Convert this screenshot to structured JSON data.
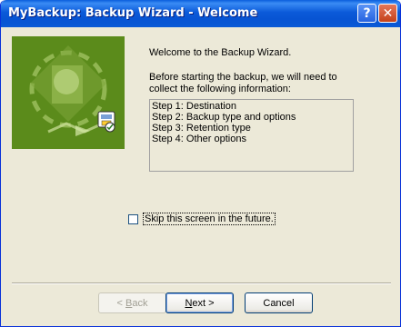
{
  "window": {
    "title": "MyBackup: Backup Wizard - Welcome",
    "help_label": "?",
    "close_label": "✕"
  },
  "content": {
    "welcome": "Welcome to the Backup Wizard.",
    "intro": "Before starting the backup, we will need to collect the following information:",
    "steps": [
      "Step 1: Destination",
      "Step 2: Backup type and options",
      "Step 3: Retention type",
      "Step 4: Other options"
    ]
  },
  "skip_checkbox": {
    "label": "Skip this screen in the future.",
    "checked": false
  },
  "buttons": {
    "back": {
      "hotkey": "B",
      "rest": "ack",
      "prefix": "< "
    },
    "next": {
      "hotkey": "N",
      "rest": "ext",
      "suffix": " >"
    },
    "cancel": "Cancel"
  },
  "colors": {
    "titlebar": "#0a5ad6",
    "dialog_bg": "#ece9d8",
    "banner_green": "#5b8b1b"
  }
}
